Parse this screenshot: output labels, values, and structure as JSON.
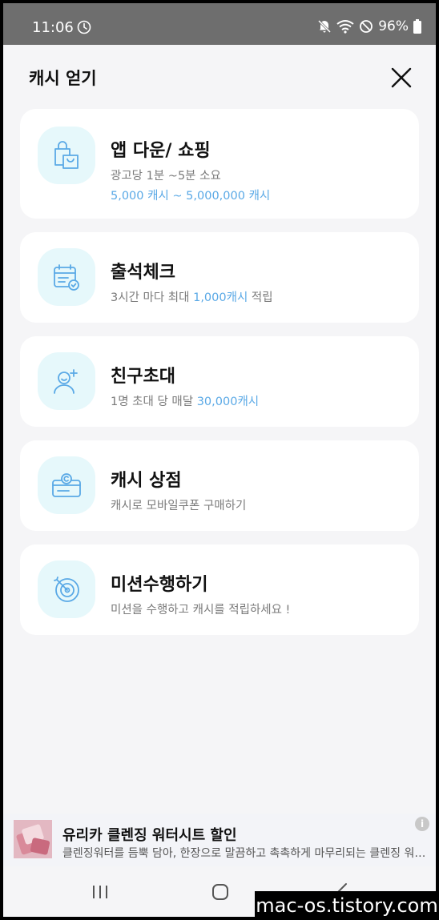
{
  "status": {
    "time": "11:06",
    "battery": "96%",
    "icons": [
      "clock-icon",
      "mute-icon",
      "wifi-icon",
      "dnd-icon",
      "battery-icon"
    ]
  },
  "header": {
    "title": "캐시 얻기"
  },
  "cards": [
    {
      "title": "앱 다운/ 쇼핑",
      "desc1": "광고당 1분 ~5분 소요",
      "desc2": "5,000 캐시 ~ 5,000,000 캐시",
      "icon": "shopping-bag-icon"
    },
    {
      "title": "출석체크",
      "desc_pre": "3시간 마다 최대 ",
      "desc_hl": "1,000캐시",
      "desc_post": " 적립",
      "icon": "calendar-check-icon"
    },
    {
      "title": "친구초대",
      "desc_pre": "1명 초대 당 매달 ",
      "desc_hl": "30,000캐시",
      "icon": "user-add-icon"
    },
    {
      "title": "캐시 상점",
      "desc": "캐시로 모바일쿠폰 구매하기",
      "icon": "cash-store-icon"
    },
    {
      "title": "미션수행하기",
      "desc": "미션을 수행하고 캐시를 적립하세요 !",
      "icon": "target-icon"
    }
  ],
  "ad": {
    "title": "유리카 클렌징 워터시트 할인",
    "desc": "클렌징워터를 듬뿍 담아, 한장으로 말끔하고 촉촉하게 마무리되는 클렌징 워터시트",
    "info": "i"
  },
  "watermark": "mac-os.tistory.com",
  "colors": {
    "accent": "#5aa9e6",
    "icon_bg": "#e6f8fb",
    "background": "#f5f5f7"
  }
}
